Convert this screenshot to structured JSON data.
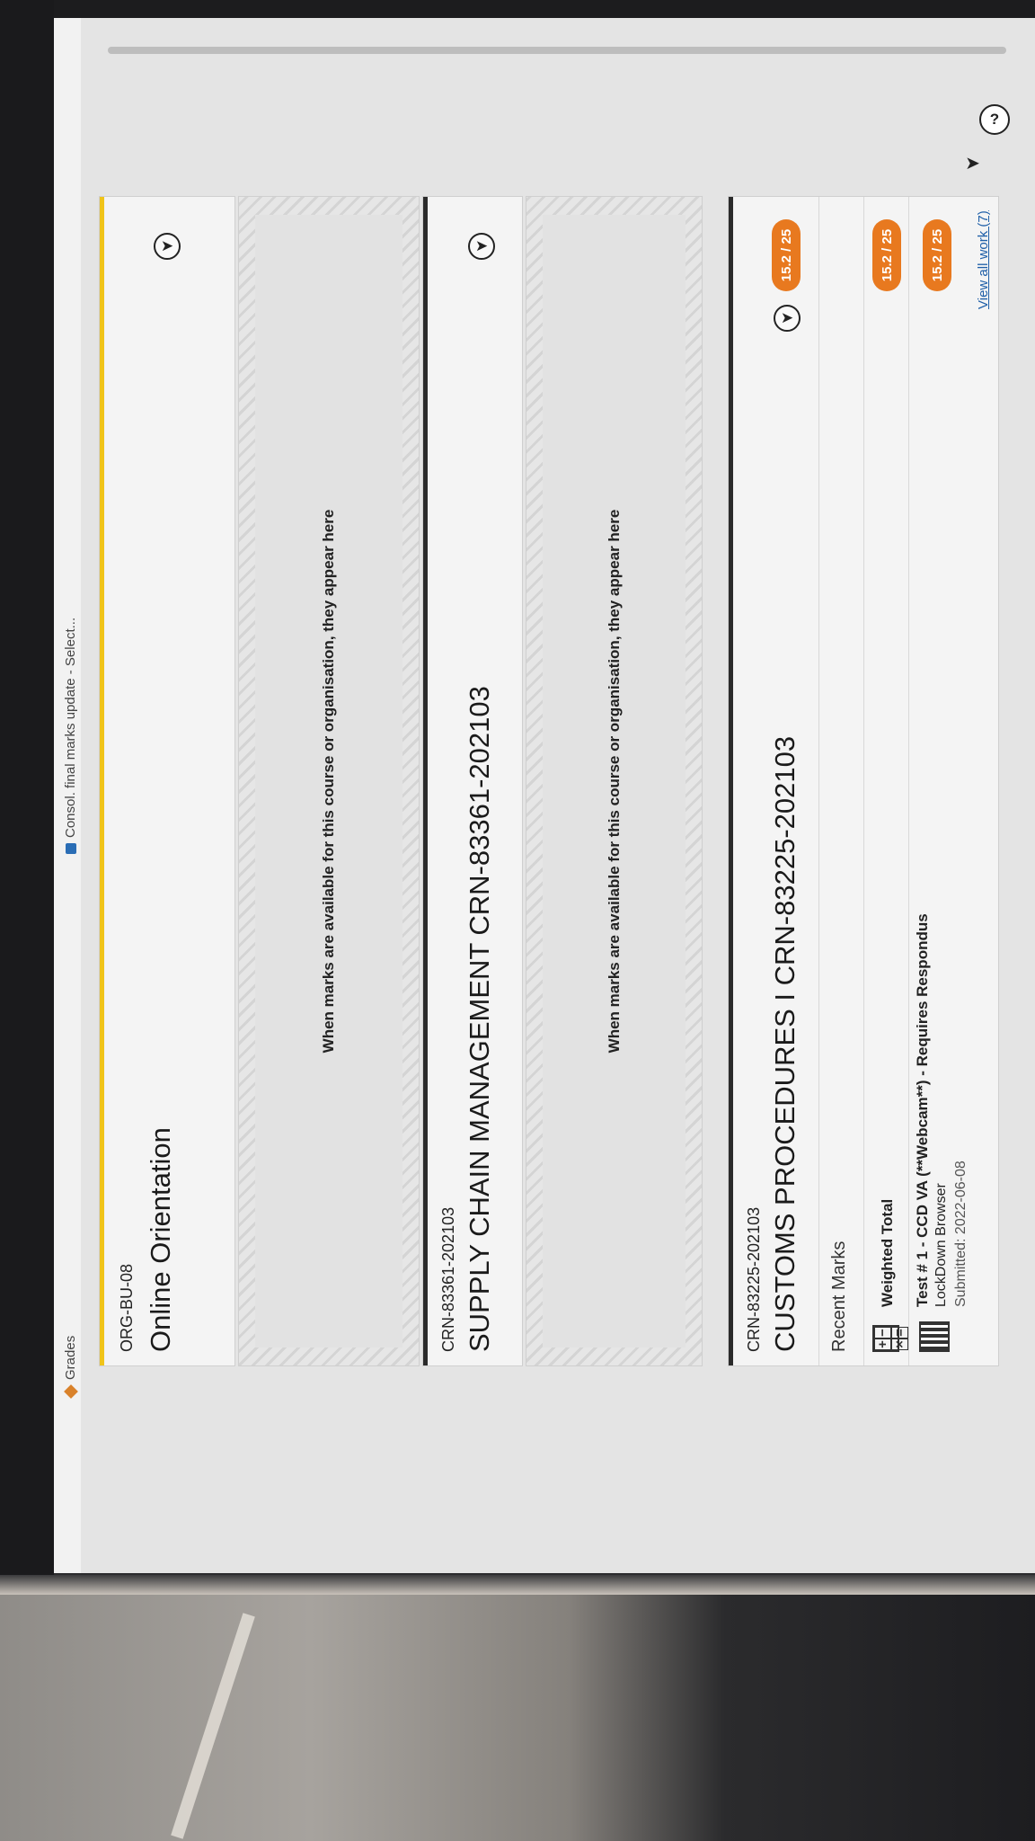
{
  "header": {
    "grades_link": "Grades",
    "filter_link": "Consol. final marks update - Select..."
  },
  "cards": [
    {
      "org_id": "ORG-BU-08",
      "title": "Online Orientation",
      "empty_message": "When marks are available for this course or organisation, they appear here",
      "accent_color": "#f0c419"
    },
    {
      "org_id": "CRN-83361-202103",
      "title": "SUPPLY CHAIN MANAGEMENT CRN-83361-202103",
      "empty_message": "When marks are available for this course or organisation, they appear here",
      "accent_color": "#2b2b2b"
    },
    {
      "org_id": "CRN-83225-202103",
      "title": "CUSTOMS PROCEDURES I CRN-83225-202103",
      "overall_grade": "15.2 / 25",
      "accent_color": "#2b2b2b",
      "recent_marks_label": "Recent Marks",
      "weighted_total_label": "Weighted Total",
      "weighted_total_grade": "15.2 / 25",
      "test": {
        "title": "Test # 1 - CCD VA (**Webcam**) - Requires Respondus",
        "subtitle": "LockDown Browser",
        "submitted": "Submitted: 2022-06-08",
        "grade": "15.2 / 25"
      },
      "view_all": "View all work (7)"
    }
  ],
  "colors": {
    "pill": "#e8791f",
    "link": "#1f5fa8",
    "page_bg": "#e4e4e4"
  },
  "icons": [
    "course-link-icon",
    "calculator-icon",
    "test-icon",
    "help-icon"
  ]
}
